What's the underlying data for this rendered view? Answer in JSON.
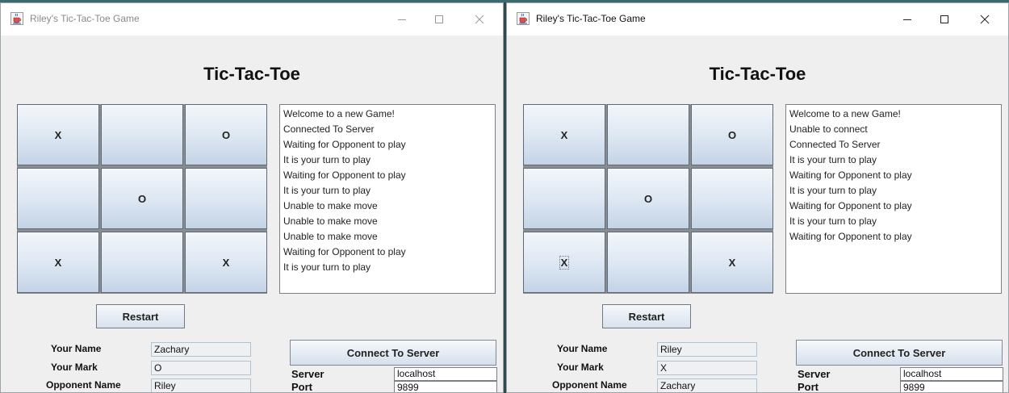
{
  "windows": [
    {
      "title": "Riley's Tic-Tac-Toe Game",
      "heading": "Tic-Tac-Toe",
      "board": [
        [
          "X",
          "",
          "O"
        ],
        [
          "",
          "O",
          ""
        ],
        [
          "X",
          "",
          "X"
        ]
      ],
      "log": [
        "Welcome to a new Game!",
        "Connected To Server",
        "Waiting for Opponent to play",
        "It is your turn to play",
        "Waiting for Opponent to play",
        "It is your turn to play",
        "Unable to make move",
        "Unable to make move",
        "Unable to make move",
        "Waiting for Opponent to play",
        "It is your turn to play"
      ],
      "restart_label": "Restart",
      "your_name_label": "Your Name",
      "your_name": "Zachary",
      "your_mark_label": "Your Mark",
      "your_mark": "O",
      "opponent_label": "Opponent Name",
      "opponent": "Riley",
      "connect_label": "Connect To Server",
      "server_label": "Server",
      "server": "localhost",
      "port_label": "Port",
      "port": "9899"
    },
    {
      "title": "Riley's Tic-Tac-Toe Game",
      "heading": "Tic-Tac-Toe",
      "board": [
        [
          "X",
          "",
          "O"
        ],
        [
          "",
          "O",
          ""
        ],
        [
          "X",
          "",
          "X"
        ]
      ],
      "log": [
        "Welcome to a new Game!",
        "Unable to connect",
        "Connected To Server",
        "It is your turn to play",
        "Waiting for Opponent to play",
        "It is your turn to play",
        "Waiting for Opponent to play",
        "It is your turn to play",
        "Waiting for Opponent to play"
      ],
      "restart_label": "Restart",
      "your_name_label": "Your Name",
      "your_name": "Riley",
      "your_mark_label": "Your Mark",
      "your_mark": "X",
      "opponent_label": "Opponent Name",
      "opponent": "Zachary",
      "connect_label": "Connect To Server",
      "server_label": "Server",
      "server": "localhost",
      "port_label": "Port",
      "port": "9899"
    }
  ],
  "icons": {
    "app": "java-cup-icon",
    "minimize": "minimize-icon",
    "maximize": "maximize-icon",
    "close": "close-icon"
  },
  "colors": {
    "board_top": "#f3f6fa",
    "board_bottom": "#c3d3e6",
    "window_bg": "#efefef"
  }
}
